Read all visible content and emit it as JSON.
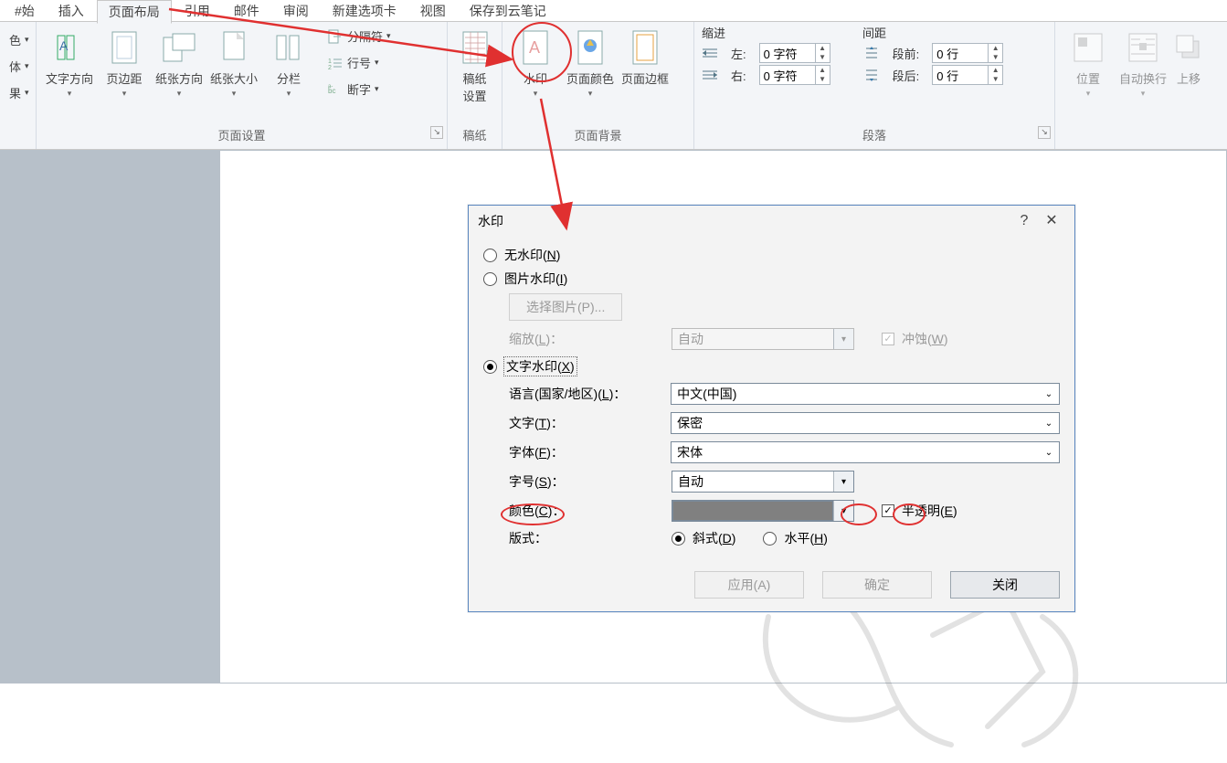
{
  "tabs": {
    "start": "#始",
    "insert": "插入",
    "layout": "页面布局",
    "references": "引用",
    "mail": "邮件",
    "review": "审阅",
    "newtab": "新建选项卡",
    "view": "视图",
    "savecloud": "保存到云笔记"
  },
  "ribbon": {
    "theme": {
      "color": "色",
      "font": "体",
      "effect": "果"
    },
    "page_setup": {
      "text_dir": "文字方向",
      "margins": "页边距",
      "orientation": "纸张方向",
      "size": "纸张大小",
      "columns": "分栏",
      "breaks": "分隔符",
      "line_no": "行号",
      "hyphen": "断字",
      "group": "页面设置"
    },
    "blotting": {
      "btn": "稿纸\n设置",
      "group": "稿纸"
    },
    "background": {
      "watermark": "水印",
      "page_color": "页面颜色",
      "page_border": "页面边框",
      "group": "页面背景"
    },
    "para": {
      "indent": "缩进",
      "left": "左:",
      "right": "右:",
      "left_val": "0 字符",
      "right_val": "0 字符",
      "spacing": "间距",
      "before": "段前:",
      "after": "段后:",
      "before_val": "0 行",
      "after_val": "0 行",
      "group": "段落"
    },
    "arrange": {
      "position": "位置",
      "wrap": "自动换行",
      "forward": "上移"
    }
  },
  "dialog": {
    "title": "水印",
    "no_wm": "无水印(N)",
    "pic_wm": "图片水印(I)",
    "select_pic": "选择图片(P)...",
    "scale": "缩放(L)：",
    "scale_val": "自动",
    "washout": "冲蚀(W)",
    "text_wm": "文字水印(X)",
    "lang": "语言(国家/地区)(L)：",
    "lang_val": "中文(中国)",
    "text": "文字(T)：",
    "text_val": "保密",
    "font": "字体(F)：",
    "font_val": "宋体",
    "size": "字号(S)：",
    "size_val": "自动",
    "color": "颜色(C)：",
    "semi": "半透明(E)",
    "layout": "版式：",
    "diag": "斜式(D)",
    "horiz": "水平(H)",
    "apply": "应用(A)",
    "ok": "确定",
    "close": "关闭"
  }
}
